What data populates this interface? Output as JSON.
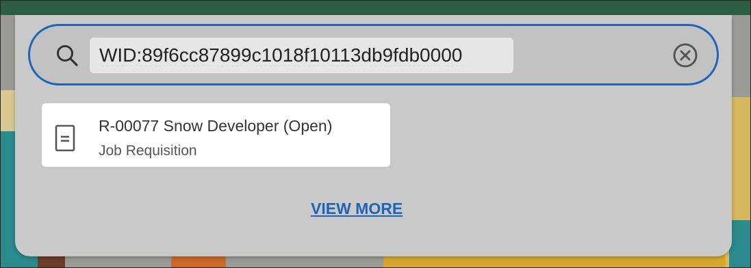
{
  "search": {
    "value": "WID:89f6cc87899c1018f10113db9fdb0000",
    "search_icon": "search-icon",
    "clear_icon": "clear-circle-icon"
  },
  "results": [
    {
      "title": "R-00077 Snow Developer (Open)",
      "subtitle": "Job Requisition",
      "icon": "document-icon"
    }
  ],
  "view_more_label": "VIEW MORE",
  "colors": {
    "accent": "#1f64b6",
    "top_bar": "#2c5e43",
    "panel_bg": "#c9c9c9",
    "result_bg": "#ffffff"
  }
}
